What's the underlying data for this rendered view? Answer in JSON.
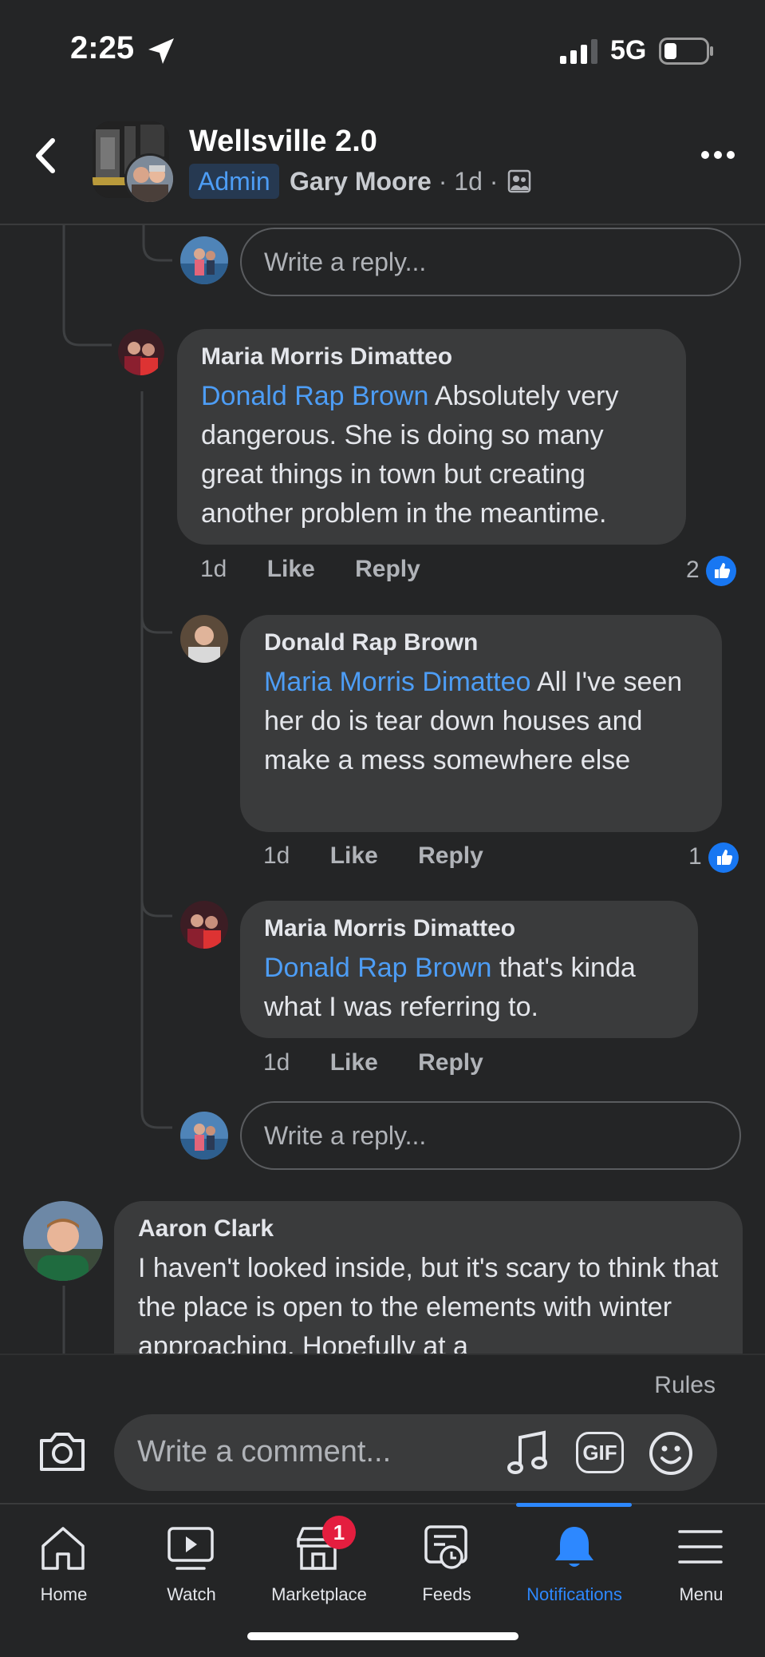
{
  "status": {
    "time": "2:25",
    "network": "5G"
  },
  "header": {
    "group_name": "Wellsville 2.0",
    "role_badge": "Admin",
    "author": "Gary Moore",
    "age": "1d"
  },
  "reply_placeholder": "Write a reply...",
  "comments": [
    {
      "author": "Maria Morris Dimatteo",
      "mention": "Donald Rap Brown",
      "text": " Absolutely very dangerous.  She is doing so many great things in town but creating another problem in the meantime.",
      "age": "1d",
      "like_label": "Like",
      "reply_label": "Reply",
      "reactions": "2"
    },
    {
      "author": "Donald Rap Brown",
      "mention": "Maria Morris Dimatteo",
      "text": "  All I've seen her do is tear down houses and make a mess somewhere else",
      "age": "1d",
      "like_label": "Like",
      "reply_label": "Reply",
      "reactions": "1"
    },
    {
      "author": "Maria Morris Dimatteo",
      "mention": "Donald Rap Brown",
      "text": " that's kinda what I was referring to.",
      "age": "1d",
      "like_label": "Like",
      "reply_label": "Reply"
    },
    {
      "author": "Aaron Clark",
      "text": "I haven't looked inside, but it's scary to think that the place is open to the elements with winter approaching.  Hopefully at a"
    }
  ],
  "composer": {
    "rules": "Rules",
    "placeholder": "Write a comment...",
    "gif_label": "GIF"
  },
  "nav": {
    "items": [
      {
        "label": "Home",
        "icon": "home-icon"
      },
      {
        "label": "Watch",
        "icon": "watch-icon"
      },
      {
        "label": "Marketplace",
        "icon": "marketplace-icon",
        "badge": "1"
      },
      {
        "label": "Feeds",
        "icon": "feeds-icon"
      },
      {
        "label": "Notifications",
        "icon": "bell-icon",
        "active": true
      },
      {
        "label": "Menu",
        "icon": "menu-icon"
      }
    ]
  },
  "colors": {
    "background": "#242526",
    "bubble": "#3a3b3c",
    "accent": "#2d88ff",
    "mention": "#4d9df5"
  }
}
